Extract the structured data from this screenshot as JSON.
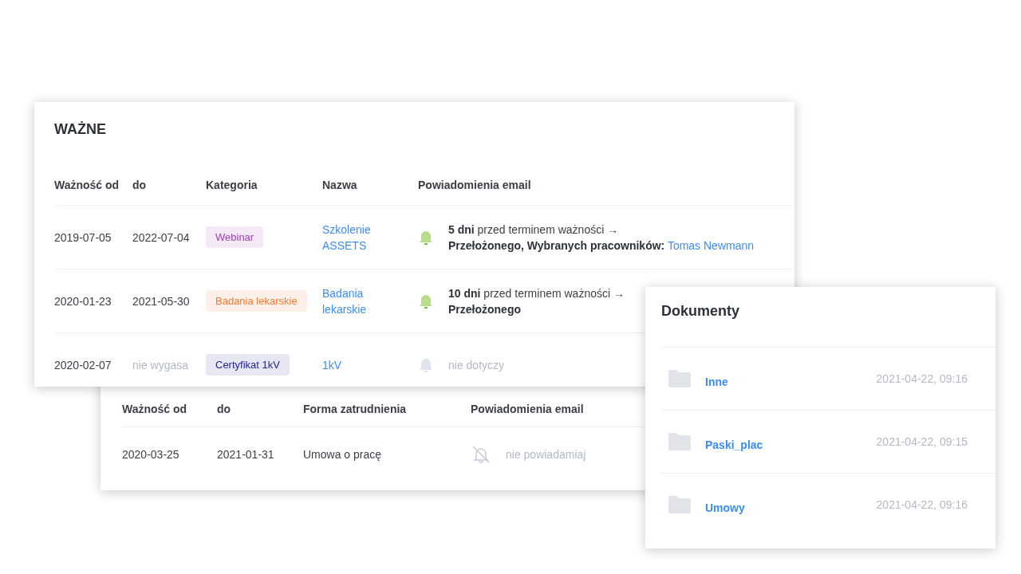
{
  "important": {
    "title": "WAŻNE",
    "columns": [
      "Ważność od",
      "do",
      "Kategoria",
      "Nazwa",
      "Powiadomienia email"
    ],
    "rows": [
      {
        "from": "2019-07-05",
        "to": "2022-07-04",
        "expires": true,
        "category": {
          "label": "Webinar",
          "color": "#a23bb3"
        },
        "name": "Szkolenie ASSETS",
        "notification": {
          "kind": "active",
          "when": "**5 dni** przed terminem ważności →",
          "recipients": "Przełożonego, Wybranych pracowników:",
          "link": "Tomas Newmann"
        }
      },
      {
        "from": "2020-01-23",
        "to": "2021-05-30",
        "expires": true,
        "category": {
          "label": "Badania lekarskie",
          "color": "#f27a2e"
        },
        "name": "Badania lekarskie",
        "notification": {
          "kind": "active",
          "when": "**10 dni** przed terminem ważności →",
          "recipients": "Przełożonego"
        }
      },
      {
        "from": "2020-02-07",
        "to": "nie wygasa",
        "expires": false,
        "category": {
          "label": "Certyfikat 1kV",
          "color": "#23238f"
        },
        "name": "1kV",
        "notification": {
          "kind": "none",
          "text": "nie dotyczy"
        }
      }
    ]
  },
  "employment": {
    "columns": [
      "Ważność od",
      "do",
      "Forma zatrudnienia",
      "Powiadomienia email"
    ],
    "rows": [
      {
        "from": "2020-03-25",
        "to": "2021-01-31",
        "form": "Umowa o pracę",
        "notification": {
          "kind": "muted",
          "text": "nie powiadamiaj"
        }
      }
    ]
  },
  "documents": {
    "title": "Dokumenty",
    "folders": [
      {
        "name": "Inne",
        "date": "2021-04-22, 09:16"
      },
      {
        "name": "Paski_plac",
        "date": "2021-04-22, 09:15"
      },
      {
        "name": "Umowy",
        "date": "2021-04-22, 09:16"
      }
    ]
  }
}
